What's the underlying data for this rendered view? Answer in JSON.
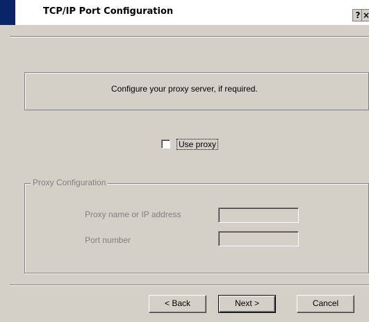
{
  "window": {
    "title": "TCP/IP Port Configuration",
    "help_glyph": "?",
    "close_glyph": "×"
  },
  "info": {
    "text": "Configure your proxy server, if required."
  },
  "use_proxy": {
    "label": "Use proxy",
    "checked": false
  },
  "proxy_group": {
    "legend": "Proxy Configuration",
    "fields": [
      {
        "label": "Proxy name or IP address",
        "value": ""
      },
      {
        "label": "Port number",
        "value": ""
      }
    ]
  },
  "buttons": {
    "back": "< Back",
    "next": "Next >",
    "cancel": "Cancel"
  },
  "colors": {
    "face": "#d4d0c8",
    "title_accent": "#0a246a",
    "disabled_text": "#808080"
  }
}
